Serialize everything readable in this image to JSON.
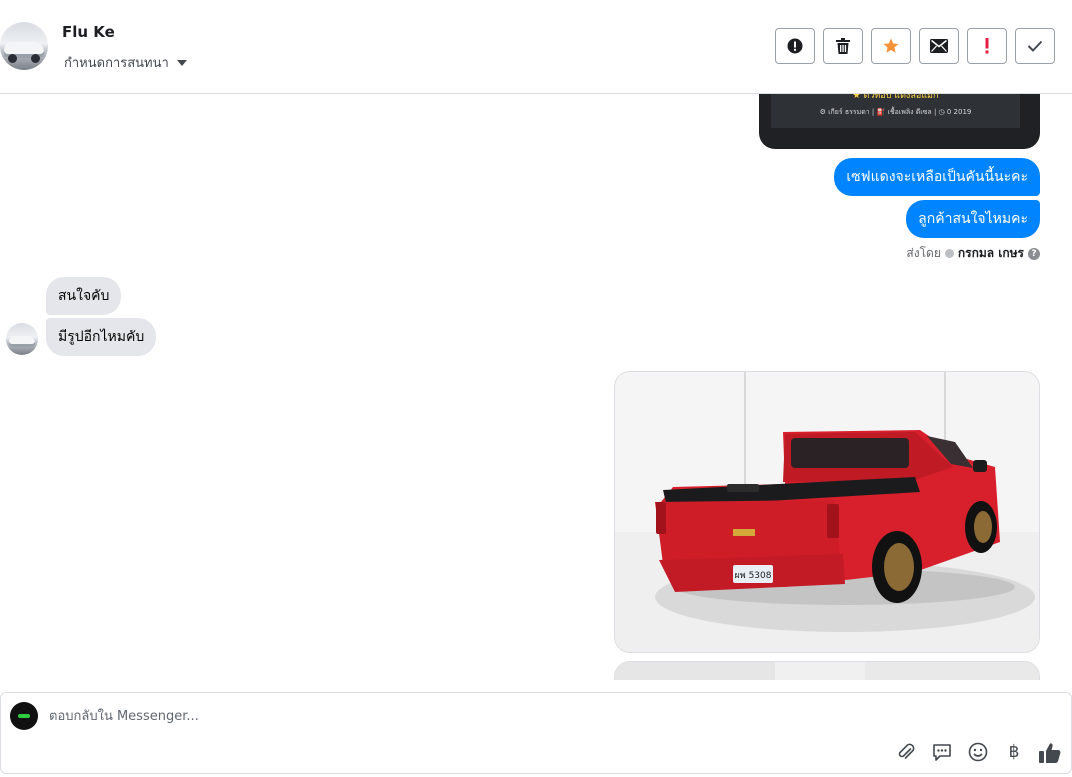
{
  "header": {
    "name": "Flu Ke",
    "assign_label": "กำหนดการสนทนา"
  },
  "toolbar": {
    "icons": [
      "alert-circle-icon",
      "trash-icon",
      "star-icon",
      "envelope-icon",
      "exclamation-icon",
      "check-icon"
    ],
    "star_color": "#f7923b",
    "exclamation_color": "#e41e3f"
  },
  "card": {
    "line1": "★ ตัวท็อป แต่งล้อแม็ก",
    "line2": "⚙ เกียร์ ธรรมดา   |   ⛽ เชื้อเพลิง ดีเซล   |   ◷ 0 2019"
  },
  "messages": {
    "outgoing": [
      "เซฟแดงจะเหลือเป็นคันนี้นะคะ",
      "ลูกค้าสนใจไหมคะ"
    ],
    "sent_by_label": "ส่งโดย",
    "sent_by_name": "กรกมล เกษร",
    "incoming": [
      "สนใจคับ",
      "มีรูปอีกไหมคับ"
    ],
    "photo_plate": "ผพ 5308"
  },
  "composer": {
    "placeholder": "ตอบกลับใน Messenger...",
    "icons": [
      "attachment-icon",
      "saved-reply-icon",
      "emoji-icon",
      "baht-icon",
      "thumbs-up-icon"
    ],
    "baht_symbol": "฿"
  },
  "colors": {
    "accent": "#0084ff",
    "incoming_bubble": "#e4e6eb"
  }
}
